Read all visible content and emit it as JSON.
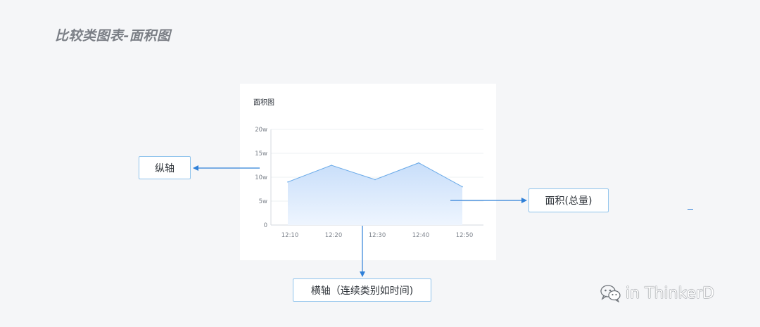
{
  "page": {
    "heading": "比较类图表-面积图"
  },
  "chart_card": {
    "title": "面积图"
  },
  "chart_data": {
    "type": "area",
    "title": "面积图",
    "x": [
      "12:10",
      "12:20",
      "12:30",
      "12:40",
      "12:50"
    ],
    "series": [
      {
        "values": [
          9,
          12.5,
          9.5,
          13,
          8
        ]
      }
    ],
    "y_ticks": [
      "0",
      "5w",
      "10w",
      "15w",
      "20w"
    ],
    "ylim": [
      0,
      20
    ],
    "grid": true,
    "colors": {
      "line": "#6aaae8",
      "fill_top": "#c8defa",
      "fill_bottom": "#eef5fe"
    }
  },
  "annotations": {
    "y_axis_label": "纵轴",
    "area_label": "面积(总量)",
    "x_axis_label": "横轴（连续类别如时间)",
    "arrow_color": "#2f80d8"
  },
  "watermark": {
    "icon": "wechat-icon",
    "text": "in ThinkerD"
  }
}
